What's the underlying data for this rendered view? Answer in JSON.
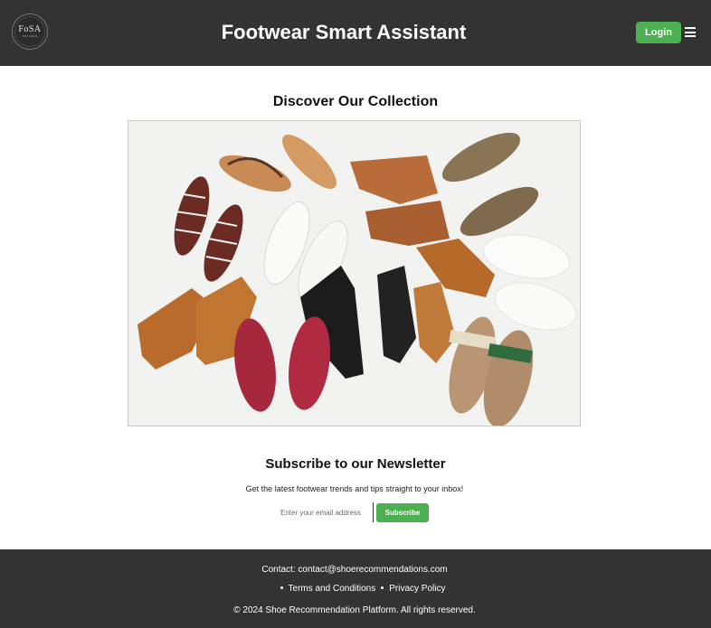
{
  "header": {
    "logo_text": "FoSA",
    "logo_subtext": "EST 2024",
    "title": "Footwear Smart Assistant",
    "login_label": "Login",
    "menu_icon": "hamburger-menu-icon"
  },
  "collection": {
    "title": "Discover Our Collection",
    "image_alt": "Assorted shoes flat lay"
  },
  "newsletter": {
    "title": "Subscribe to our Newsletter",
    "description": "Get the latest footwear trends and tips straight to your inbox!",
    "email_placeholder": "Enter your email address",
    "subscribe_label": "Subscribe"
  },
  "footer": {
    "contact": "Contact: contact@shoerecommendations.com",
    "links": [
      "Terms and Conditions",
      "Privacy Policy"
    ],
    "copyright": "© 2024 Shoe Recommendation Platform. All rights reserved."
  },
  "colors": {
    "header_bg": "#333333",
    "accent": "#4caf50",
    "footer_bg": "#333333"
  }
}
